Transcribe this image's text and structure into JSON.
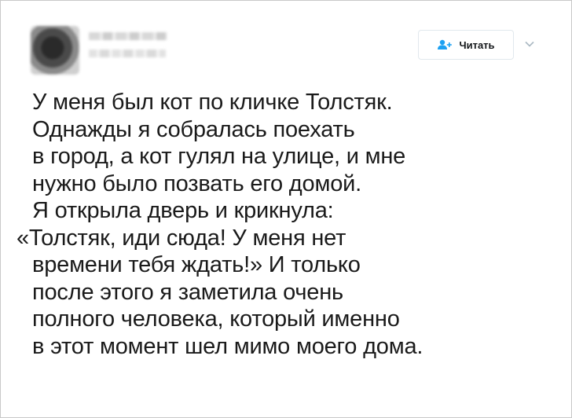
{
  "tweet": {
    "follow_label": "Читать",
    "lines": [
      "У меня был кот по кличке Толстяк.",
      "Однажды я собралась поехать",
      "в город, а кот гулял на улице, и мне",
      "нужно было позвать его домой.",
      "Я открыла дверь и крикнула:",
      "«Толстяк, иди сюда! У меня нет",
      "времени тебя ждать!» И только",
      "после этого я заметила очень",
      "полного человека, который именно",
      "в этот момент шел мимо моего дома."
    ]
  },
  "colors": {
    "accent": "#1da1f2",
    "text": "#1a1a1a",
    "border": "#c9c9c9"
  },
  "icons": {
    "follow": "add-user-icon",
    "menu": "chevron-down-icon"
  }
}
